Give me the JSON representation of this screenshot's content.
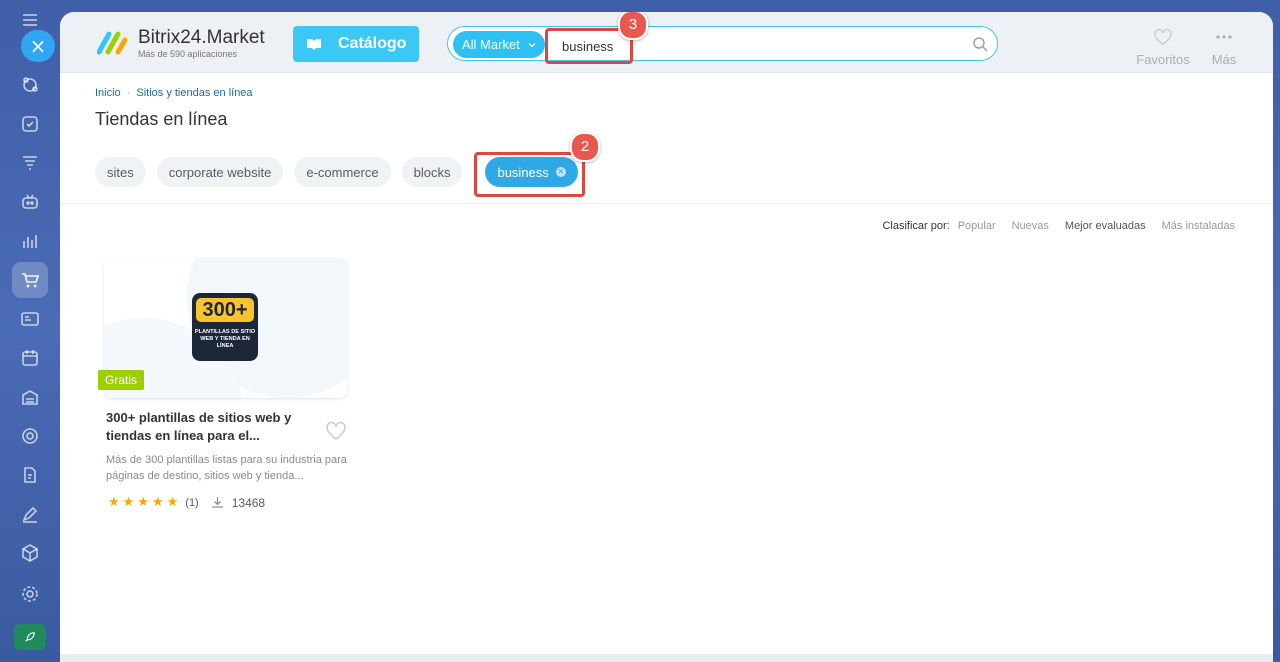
{
  "header": {
    "brand_name": "Bitrix24.Market",
    "brand_sub": "Más de 590 aplicaciones",
    "catalog_label": "Catálogo",
    "search_scope": "All Market",
    "search_value": "business",
    "favorites_label": "Favoritos",
    "more_label": "Más"
  },
  "annotations": {
    "badge_tag": "2",
    "badge_search": "3"
  },
  "breadcrumb": {
    "home": "Inicio",
    "section": "Sitios y tiendas en línea"
  },
  "page_title": "Tiendas en línea",
  "tags": [
    {
      "label": "sites"
    },
    {
      "label": "corporate website"
    },
    {
      "label": "e-commerce"
    },
    {
      "label": "blocks"
    },
    {
      "label": "business",
      "active": true
    }
  ],
  "sort": {
    "label": "Clasificar por:",
    "options": [
      "Popular",
      "Nuevas",
      "Mejor evaluadas",
      "Más instaladas"
    ],
    "selected": "Mejor evaluadas"
  },
  "apps": [
    {
      "icon_big": "300+",
      "icon_small": "PLANTILLAS DE SITIO WEB Y TIENDA EN LÍNEA",
      "price_badge": "Gratis",
      "title": "300+ plantillas de sitios web y tiendas en línea para el...",
      "description": "Más de 300 plantillas listas para su industria para páginas de destino, sitios web y tienda...",
      "stars": "★★★★★",
      "rating_count": "(1)",
      "installs": "13468"
    }
  ],
  "colors": {
    "accent": "#3bc8f5",
    "highlight": "#e0473c",
    "free_badge": "#9dcf00",
    "star": "#f7a700"
  }
}
